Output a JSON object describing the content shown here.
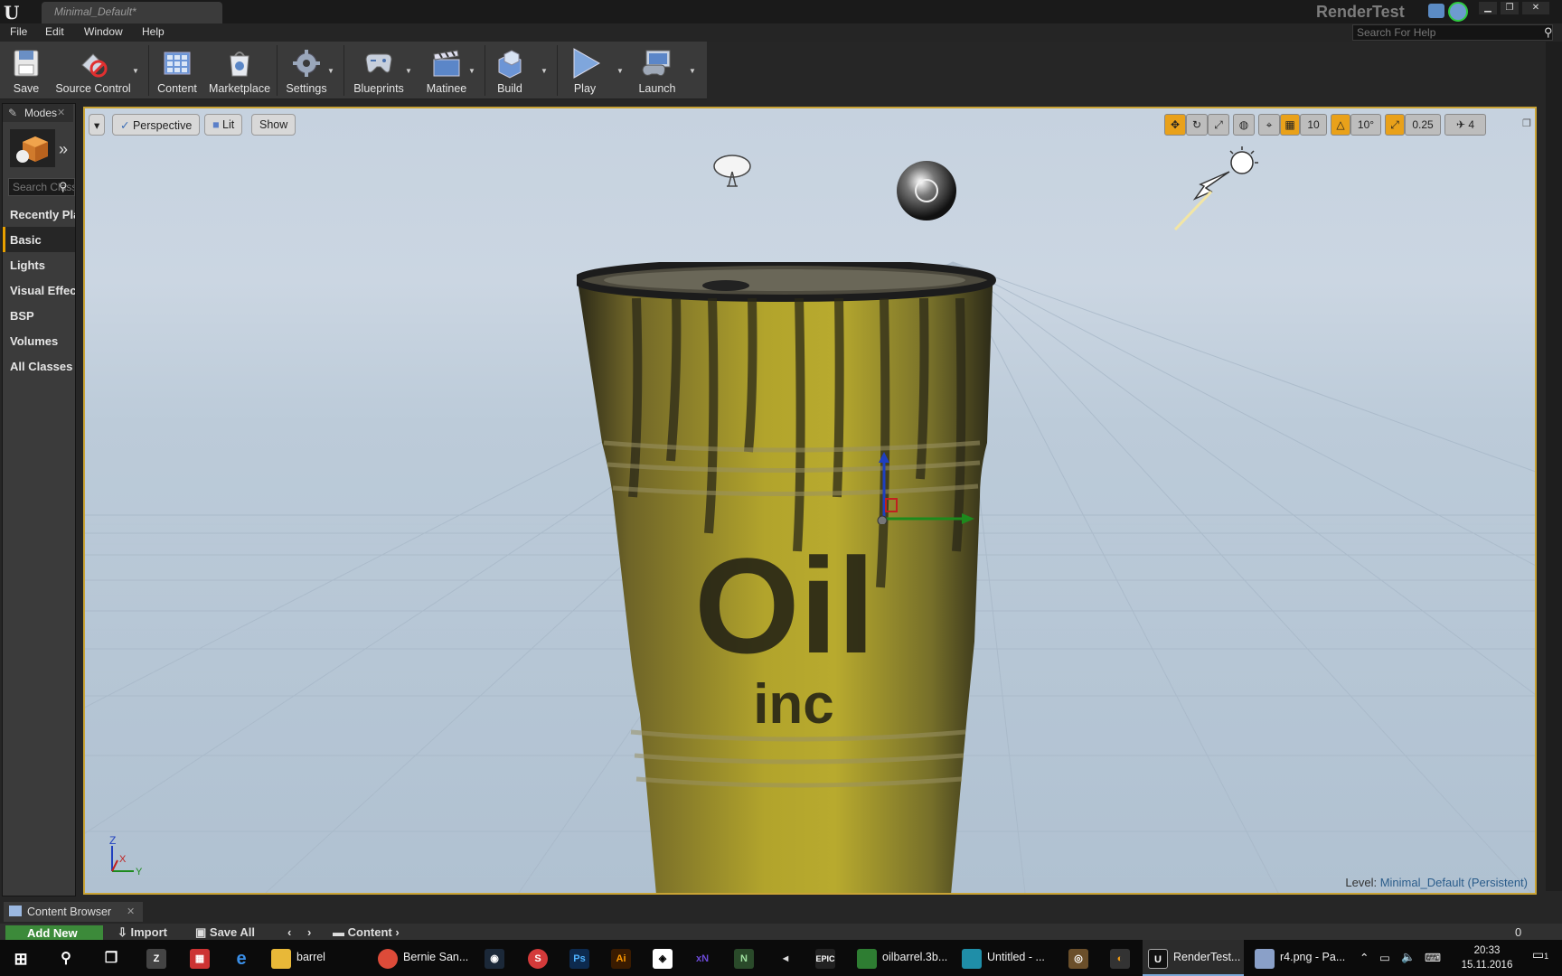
{
  "titlebar": {
    "doc_tab": "Minimal_Default*",
    "project_name": "RenderTest"
  },
  "menu": {
    "items": [
      "File",
      "Edit",
      "Window",
      "Help"
    ],
    "help_search_placeholder": "Search For Help"
  },
  "toolbar": {
    "buttons": [
      {
        "label": "Save",
        "icon": "save-icon"
      },
      {
        "label": "Source Control",
        "icon": "source-control-icon"
      },
      {
        "label": "Content",
        "icon": "content-icon"
      },
      {
        "label": "Marketplace",
        "icon": "marketplace-icon"
      },
      {
        "label": "Settings",
        "icon": "settings-icon"
      },
      {
        "label": "Blueprints",
        "icon": "blueprints-icon"
      },
      {
        "label": "Matinee",
        "icon": "matinee-icon"
      },
      {
        "label": "Build",
        "icon": "build-icon"
      },
      {
        "label": "Play",
        "icon": "play-icon"
      },
      {
        "label": "Launch",
        "icon": "launch-icon"
      }
    ]
  },
  "modes": {
    "tab_label": "Modes",
    "search_placeholder": "Search Classes",
    "categories": [
      "Recently Placed",
      "Basic",
      "Lights",
      "Visual Effects",
      "BSP",
      "Volumes",
      "All Classes"
    ],
    "active_category": "Basic"
  },
  "viewport": {
    "perspective_label": "Perspective",
    "lit_label": "Lit",
    "show_label": "Show",
    "grid_snap": "10",
    "rotation_snap": "10°",
    "scale_snap": "0.25",
    "camera_speed": "4",
    "level_prefix": "Level:",
    "level_name": "Minimal_Default (Persistent)",
    "barrel_text": [
      "Oil",
      "inc"
    ],
    "axis_labels": [
      "Z",
      "X",
      "Y"
    ]
  },
  "content_browser": {
    "tab_label": "Content Browser",
    "add_new": "Add New",
    "import": "Import",
    "save_all": "Save All",
    "path": "Content",
    "count": "0"
  },
  "taskbar": {
    "items": [
      {
        "label": "barrel",
        "icon": "folder-icon"
      },
      {
        "label": "Bernie San...",
        "icon": "chrome-icon"
      },
      {
        "label": "oilbarrel.3b...",
        "icon": "substance-icon"
      },
      {
        "label": "Untitled - ...",
        "icon": "editor-icon"
      },
      {
        "label": "RenderTest...",
        "icon": "unreal-icon"
      },
      {
        "label": "r4.png - Pa...",
        "icon": "paint-icon"
      }
    ],
    "pinned_icons": [
      "ps-label",
      "ai-label",
      "xn-label",
      "epic-label"
    ],
    "pinned": {
      "ps": "Ps",
      "ai": "Ai",
      "xn": "xN",
      "epic": "EPIC"
    },
    "time": "20:33",
    "date": "15.11.2016",
    "notifications": "1"
  },
  "colors": {
    "accent_orange": "#e9a11a",
    "viewport_border": "#c9a335",
    "barrel_yellow": "#b8a92a",
    "add_new_green": "#3c8a3a"
  }
}
